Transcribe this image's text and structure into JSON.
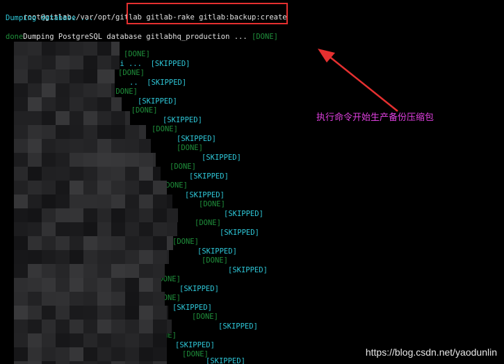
{
  "terminal": {
    "prompt": "root@gitlab:/var/opt/gitlab",
    "command": "gitlab-rake gitlab:backup:create",
    "lines": [
      {
        "id": "l-dumping-db",
        "text": "Dumping database ...",
        "cls": "c-cyan"
      },
      {
        "id": "l-dumping-pg",
        "text": "Dumping PostgreSQL database gitlabhq_production ... ",
        "cls": "c-white",
        "suffix": "[DONE]",
        "suffix_cls": "c-dgreen"
      },
      {
        "id": "l-done",
        "text": "done",
        "cls": "c-dgreen"
      }
    ],
    "status_fragments": [
      {
        "text": "[DONE]",
        "cls": "c-dgreen"
      },
      {
        "text": "ki ...  [SKIPPED]",
        "cls": "c-cyan",
        "pre": "ki ...  "
      },
      {
        "text": "[DONE]",
        "cls": "c-dgreen"
      },
      {
        "text": "..  [SKIPPED]",
        "cls": "c-cyan"
      },
      {
        "text": "[DONE]",
        "cls": "c-dgreen"
      },
      {
        "text": "[SKIPPED]",
        "cls": "c-cyan"
      },
      {
        "text": ". [DONE]",
        "cls": "c-dgreen"
      },
      {
        "text": "[SKIPPED]",
        "cls": "c-cyan"
      },
      {
        "text": "[DONE]",
        "cls": "c-dgreen"
      },
      {
        "text": "[SKIPPED]",
        "cls": "c-cyan"
      },
      {
        "text": "[DONE]",
        "cls": "c-dgreen"
      },
      {
        "text": "[SKIPPED]",
        "cls": "c-cyan"
      },
      {
        "text": "[DONE]",
        "cls": "c-dgreen"
      },
      {
        "text": "[SKIPPED]",
        "cls": "c-cyan"
      },
      {
        "text": "[DONE]",
        "cls": "c-dgreen"
      },
      {
        "text": "[SKIPPED]",
        "cls": "c-cyan"
      },
      {
        "text": "[DONE]",
        "cls": "c-dgreen"
      },
      {
        "text": "[SKIPPED]",
        "cls": "c-cyan"
      },
      {
        "text": "[DONE]",
        "cls": "c-dgreen"
      },
      {
        "text": "[SKIPPED]",
        "cls": "c-cyan"
      },
      {
        "text": "[DONE]",
        "cls": "c-dgreen"
      },
      {
        "text": "[SKIPPED]",
        "cls": "c-cyan"
      },
      {
        "text": "[DONE]",
        "cls": "c-dgreen"
      },
      {
        "text": "[SKIPPED]",
        "cls": "c-cyan"
      },
      {
        "text": "[DONE]",
        "cls": "c-dgreen"
      },
      {
        "text": "[SKIPPED]",
        "cls": "c-cyan"
      },
      {
        "text": "[DONE]",
        "cls": "c-dgreen"
      },
      {
        "text": "[SKIPPED]",
        "cls": "c-cyan"
      },
      {
        "text": "[DONE]",
        "cls": "c-dgreen"
      },
      {
        "text": "[SKIPPED]",
        "cls": "c-cyan"
      },
      {
        "text": "[DONE]",
        "cls": "c-dgreen"
      },
      {
        "text": "[SKIPPED]",
        "cls": "c-cyan"
      },
      {
        "text": "[DONE]",
        "cls": "c-dgreen"
      },
      {
        "text": "[SKIPPED]",
        "cls": "c-cyan"
      },
      {
        "text": "[DONE]",
        "cls": "c-dgreen"
      },
      {
        "text": "[SKIPPED]",
        "cls": "c-cyan"
      }
    ]
  },
  "annotation": {
    "text": "执行命令开始生产备份压缩包",
    "color": "#e040e0"
  },
  "highlight": {
    "color": "#e53030"
  },
  "watermark": {
    "text": "https://blog.csdn.net/yaodunlin"
  }
}
